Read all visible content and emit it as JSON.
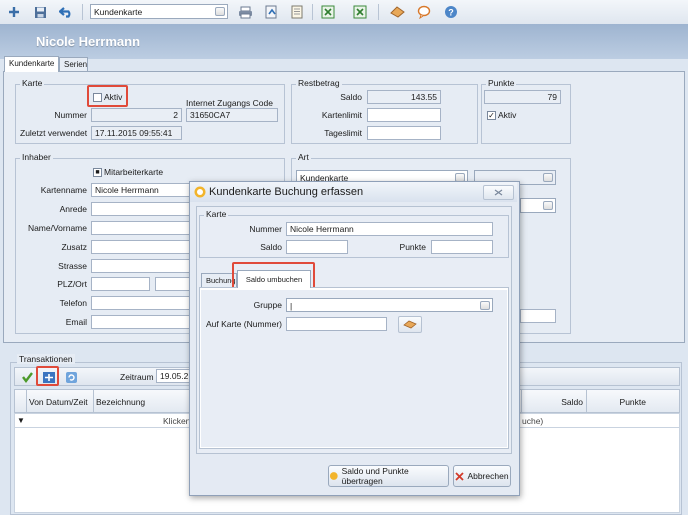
{
  "toolbar": {
    "card_type_value": "Kundenkarte",
    "icons": [
      "add-icon",
      "save-icon",
      "undo-icon",
      "print-icon",
      "export-icon",
      "document-icon",
      "excel-icon",
      "excel-export-icon",
      "eraser-icon",
      "comment-icon",
      "help-icon"
    ]
  },
  "header": {
    "title": "Nicole Herrmann"
  },
  "tabs": [
    "Kundenkarte",
    "Serien"
  ],
  "karte": {
    "group_title": "Karte",
    "aktiv_label": "Aktiv",
    "nummer_label": "Nummer",
    "nummer_value": "2",
    "code_label": "Internet Zugangs Code",
    "code_value": "31650CA7",
    "zuletzt_label": "Zuletzt verwendet",
    "zuletzt_value": "17.11.2015 09:55:41"
  },
  "restbetrag": {
    "group_title": "Restbetrag",
    "saldo_label": "Saldo",
    "saldo_value": "143.55",
    "kartenlimit_label": "Kartenlimit",
    "tageslimit_label": "Tageslimit"
  },
  "punkte": {
    "group_title": "Punkte",
    "value": "79",
    "aktiv_label": "Aktiv"
  },
  "inhaber": {
    "group_title": "Inhaber",
    "mitarbeiter_label": "Mitarbeiterkarte",
    "kartenname_label": "Kartenname",
    "kartenname_value": "Nicole Herrmann",
    "anrede_label": "Anrede",
    "name_label": "Name/Vorname",
    "zusatz_label": "Zusatz",
    "strasse_label": "Strasse",
    "plz_label": "PLZ/Ort",
    "telefon_label": "Telefon",
    "email_label": "Email"
  },
  "art": {
    "group_title": "Art",
    "value": "Kundenkarte"
  },
  "transaktionen": {
    "group_title": "Transaktionen",
    "zeitraum_label": "Zeitraum",
    "zeitraum_value": "19.05.2",
    "columns": [
      "Von Datum/Zeit",
      "Bezeichnung",
      "Saldo",
      "Punkte"
    ],
    "filter_text": "Klicken",
    "filter_text_right": "uche)"
  },
  "dialog": {
    "title": "Kundenkarte Buchung erfassen",
    "karte_group": "Karte",
    "nummer_label": "Nummer",
    "nummer_value": "Nicole Herrmann",
    "saldo_label": "Saldo",
    "punkte_label": "Punkte",
    "tabs": [
      "Buchung",
      "Saldo umbuchen"
    ],
    "gruppe_label": "Gruppe",
    "gruppe_value": "|",
    "auf_karte_label": "Auf Karte (Nummer)",
    "submit_label": "Saldo und Punkte übertragen",
    "cancel_label": "Abbrechen"
  },
  "colors": {
    "highlight": "#e04a3a",
    "header_bg": "#a9bed9",
    "accent": "#2b6cb0"
  }
}
